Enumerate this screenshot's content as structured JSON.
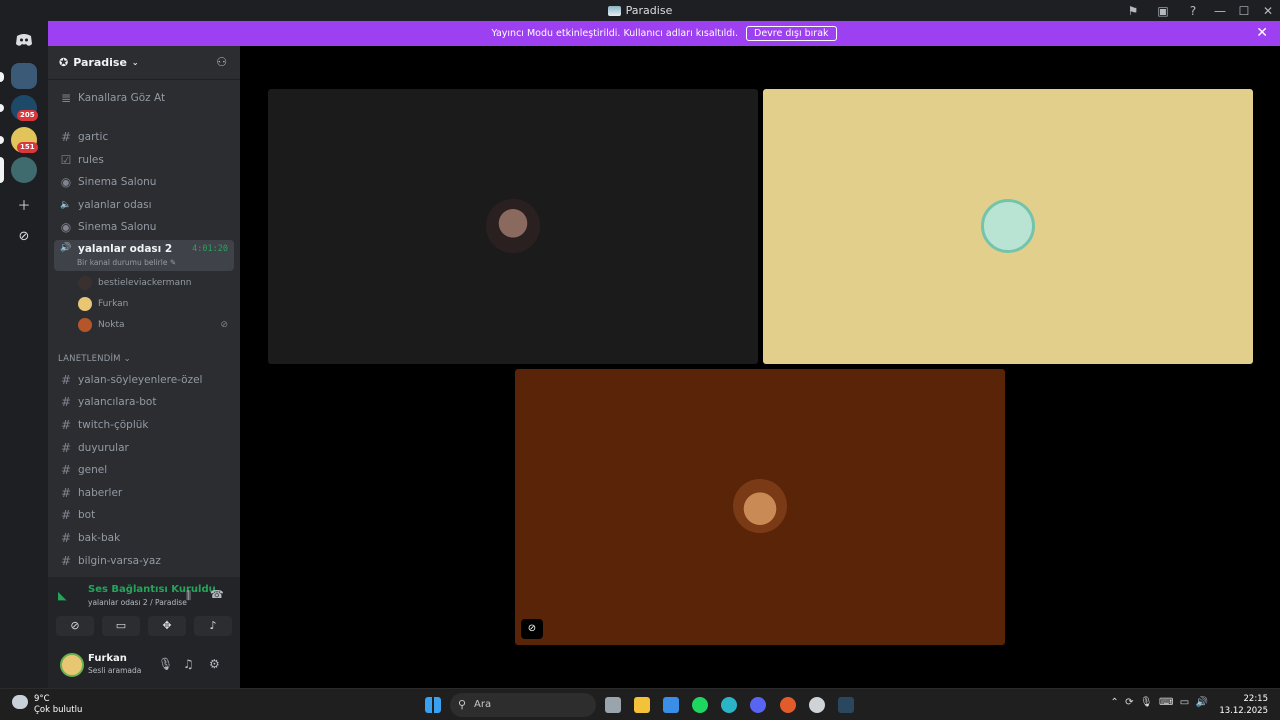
{
  "window": {
    "title": "Paradise"
  },
  "banner": {
    "message": "Yayıncı Modu etkinleştirildi. Kullanıcı adları kısaltıldı.",
    "button_label": "Devre dışı bırak"
  },
  "servers": {
    "badges": [
      "205",
      "151"
    ]
  },
  "sidebar": {
    "server_name": "Paradise",
    "browse_label": "Kanallara Göz At",
    "channels_top": [
      {
        "icon": "#",
        "name": "gartic"
      },
      {
        "icon": "☑",
        "name": "rules"
      },
      {
        "icon": "◉",
        "name": "Sinema Salonu"
      },
      {
        "icon": "🔈",
        "name": "yalanlar odası"
      },
      {
        "icon": "◉",
        "name": "Sinema Salonu"
      }
    ],
    "active_channel": {
      "name": "yalanlar odası 2",
      "timer": "4:01:20",
      "status": "Bir kanal durumu belirle"
    },
    "voice_users": [
      "bestieleviackermann",
      "Furkan",
      "Nokta"
    ],
    "category": "LANETLENDİM",
    "channels_bottom": [
      "yalan-söyleyenlere-özel",
      "yalancılara-bot",
      "twitch-çöplük",
      "duyurular",
      "genel",
      "haberler",
      "bot",
      "bak-bak",
      "bilgin-varsa-yaz"
    ]
  },
  "voice_panel": {
    "status": "Ses Bağlantısı Kuruldu",
    "location": "yalanlar odası 2 / Paradise",
    "user_name": "Furkan",
    "user_status": "Sesli aramada"
  },
  "taskbar": {
    "temp": "9°C",
    "weather": "Çok bulutlu",
    "search_placeholder": "Ara",
    "time": "22:15",
    "date": "13.12.2025"
  },
  "colors": {
    "accent": "#9d40f1",
    "online": "#23a55a",
    "tile_left": "#1c1b1c",
    "tile_right": "#e3cf8c",
    "tile_bottom": "#5a2408"
  }
}
